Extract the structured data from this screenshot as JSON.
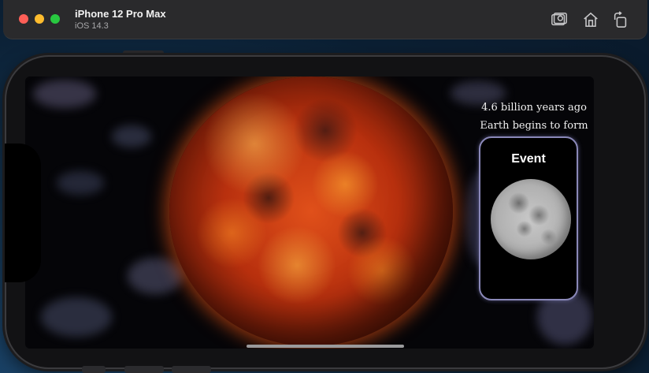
{
  "simulator": {
    "device_name": "iPhone 12 Pro Max",
    "os_version": "iOS 14.3",
    "toolbar": {
      "screenshot_icon": "camera-screenshot-icon",
      "home_icon": "home-icon",
      "rotate_icon": "rotate-icon"
    }
  },
  "app": {
    "headline_line1": "4.6 billion years ago",
    "headline_line2": "Earth begins to form",
    "event_card": {
      "title": "Event",
      "image": "moon"
    },
    "main_image": "molten-earth"
  },
  "colors": {
    "card_border": "#8a88b8",
    "screen_bg": "#050508",
    "planet_core": "#e0501a"
  }
}
